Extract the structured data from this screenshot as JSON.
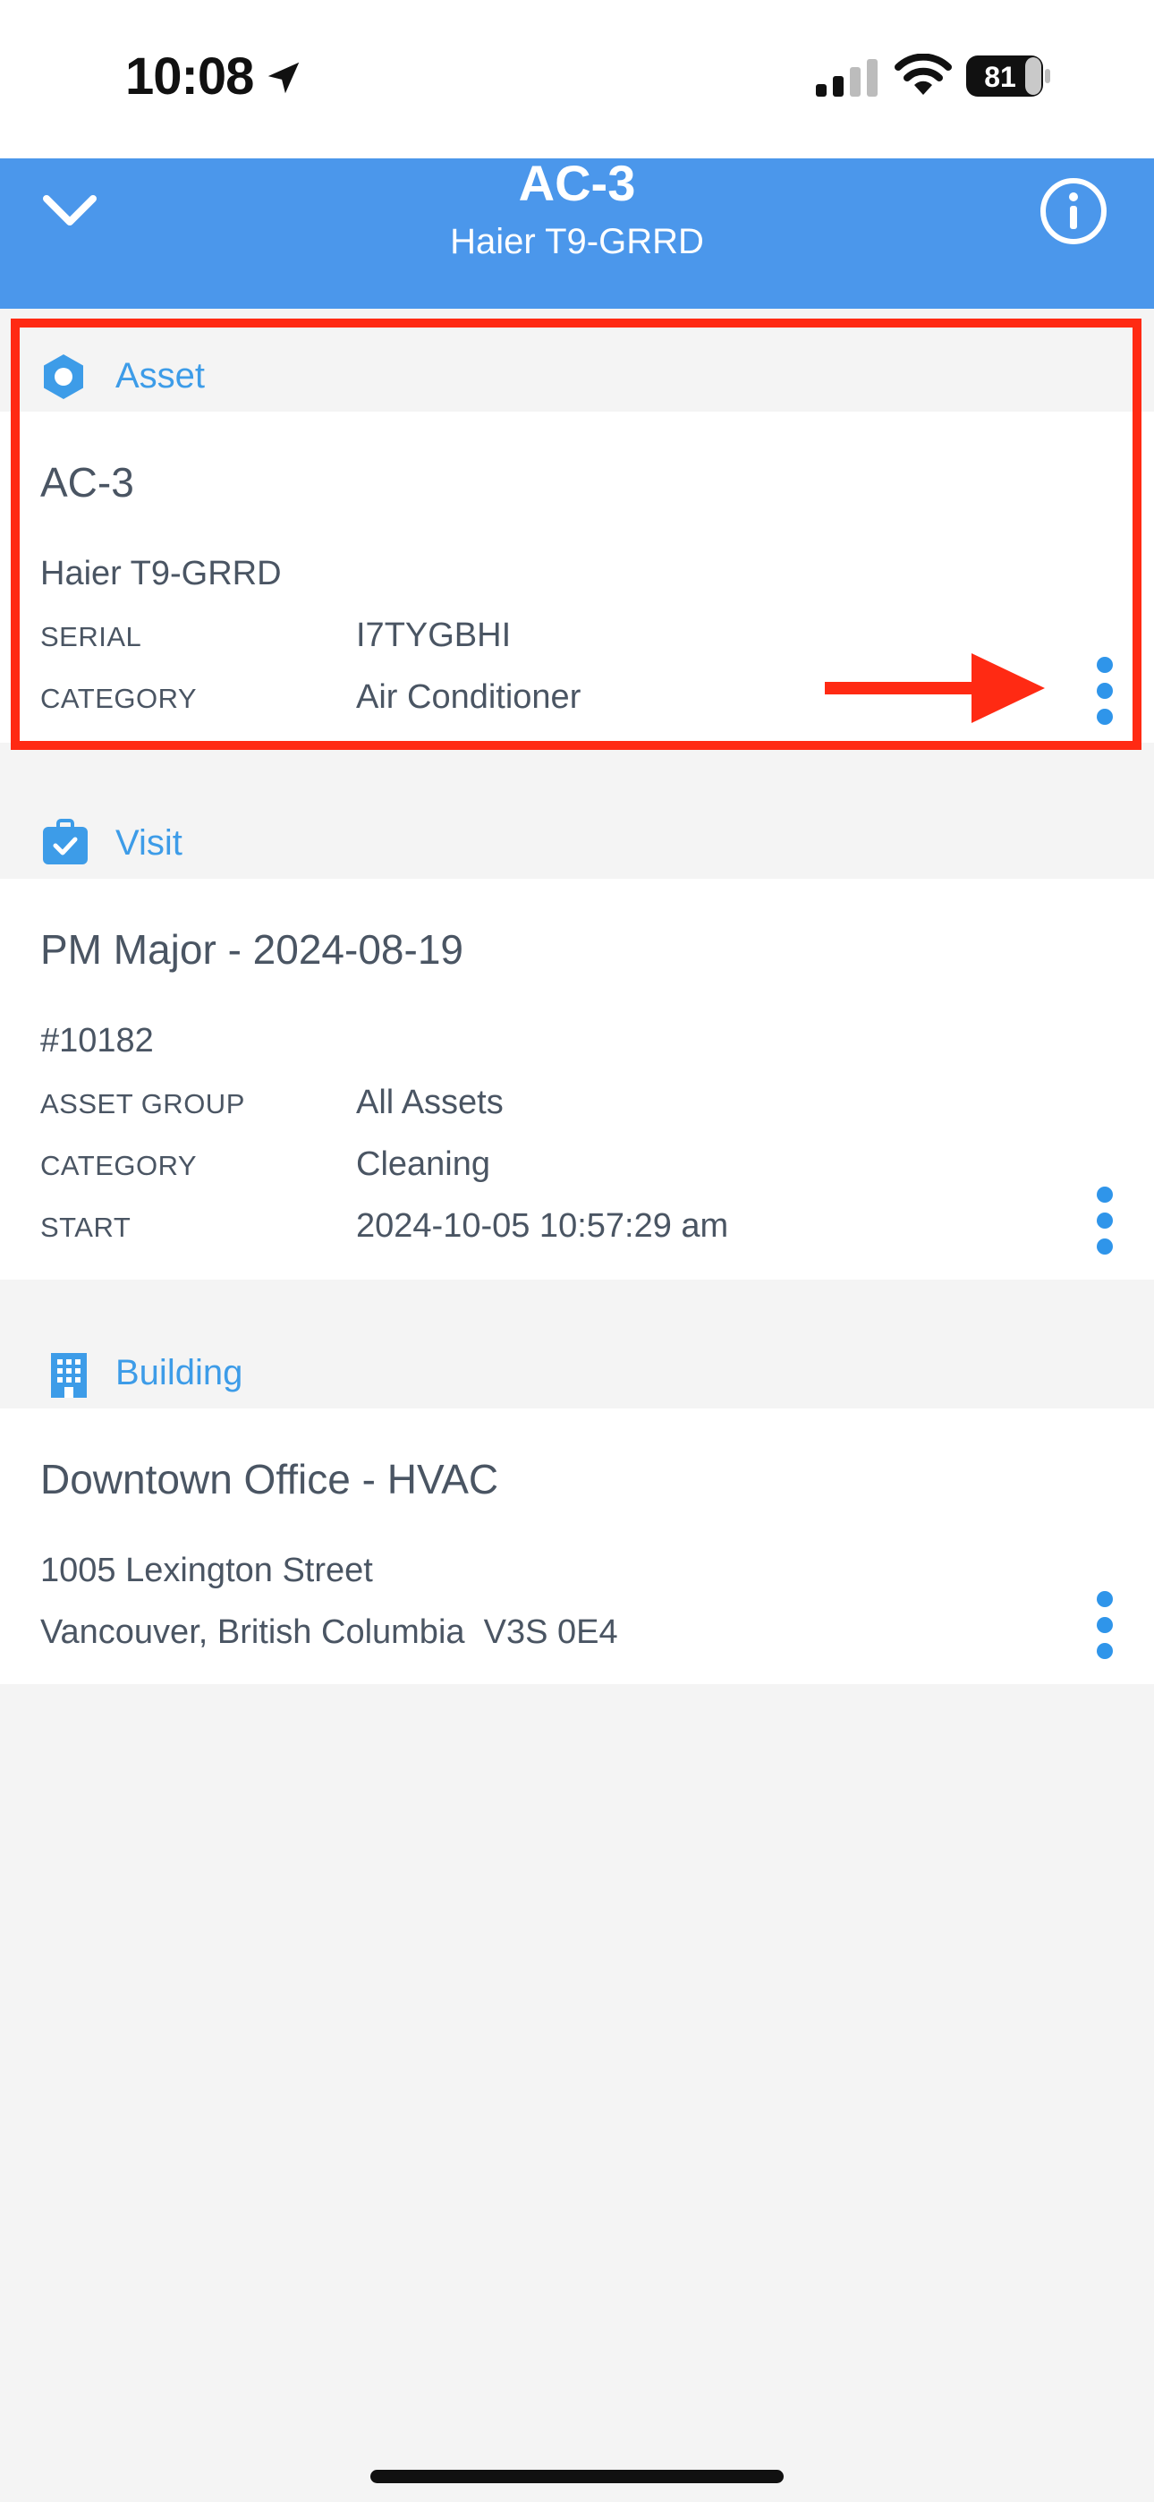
{
  "status_bar": {
    "time": "10:08",
    "battery": "81"
  },
  "header": {
    "title": "AC-3",
    "subtitle": "Haier T9-GRRD"
  },
  "asset": {
    "section_label": "Asset",
    "title": "AC-3",
    "model": "Haier T9-GRRD",
    "serial_label": "SERIAL",
    "serial_value": "I7TYGBHI",
    "category_label": "CATEGORY",
    "category_value": "Air Conditioner"
  },
  "visit": {
    "section_label": "Visit",
    "title": "PM Major - 2024-08-19",
    "number": "#10182",
    "asset_group_label": "ASSET GROUP",
    "asset_group_value": "All Assets",
    "category_label": "CATEGORY",
    "category_value": "Cleaning",
    "start_label": "START",
    "start_value": "2024-10-05 10:57:29 am"
  },
  "building": {
    "section_label": "Building",
    "title": "Downtown Office - HVAC",
    "address_line1": "1005 Lexington Street",
    "address_line2": "Vancouver, British Columbia  V3S 0E4"
  },
  "colors": {
    "header_bg": "#4b97eb",
    "accent": "#3d9ce8",
    "highlight": "#ff2a13"
  },
  "icons": [
    "location-arrow-icon",
    "signal-icon",
    "wifi-icon",
    "battery-icon",
    "chevron-down-icon",
    "info-icon",
    "hexagon-icon",
    "briefcase-check-icon",
    "building-icon",
    "more-vertical-icon",
    "arrow-right-icon"
  ]
}
